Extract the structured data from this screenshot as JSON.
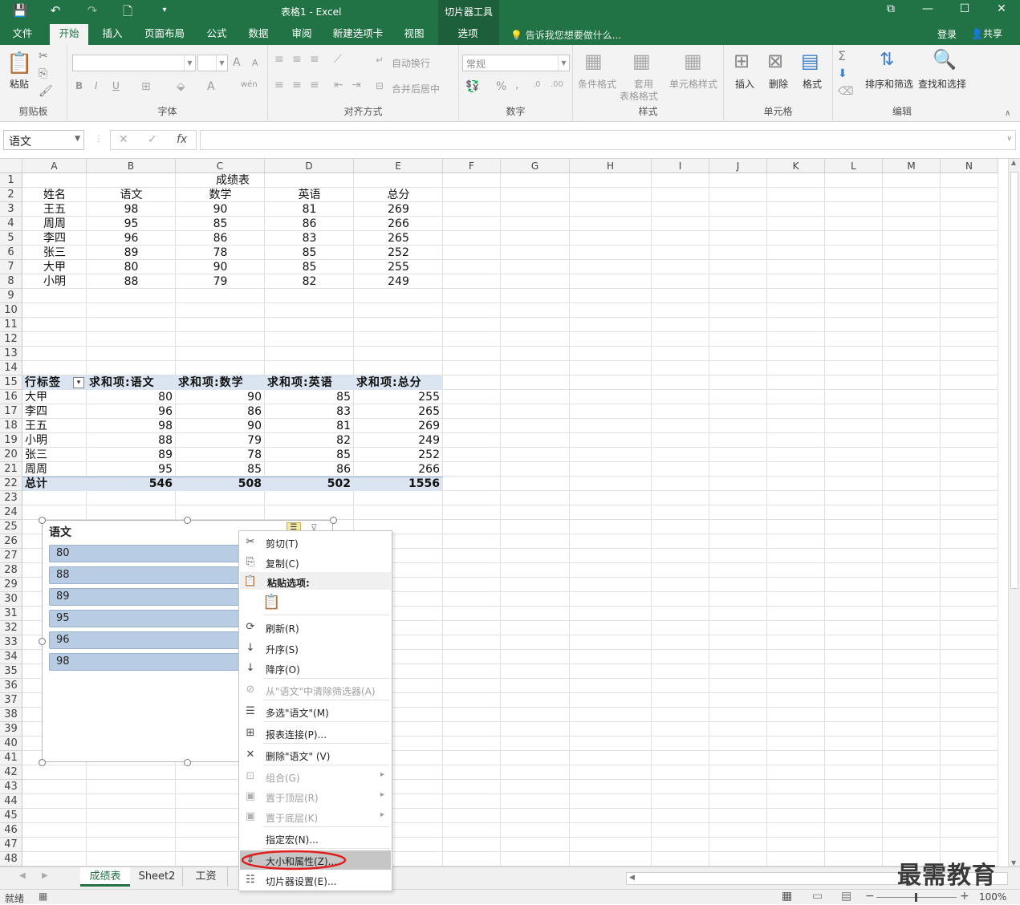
{
  "window": {
    "title": "表格1 - Excel",
    "context_tool": "切片器工具",
    "buttons": {
      "restore": "⧉",
      "minimize": "—",
      "maximize": "☐",
      "close": "✕"
    }
  },
  "qat": {
    "save_icon": "💾",
    "undo_icon": "↶",
    "redo_icon": "↷",
    "new_icon": "🗋",
    "customize_icon": "▾"
  },
  "tabs": [
    "文件",
    "开始",
    "插入",
    "页面布局",
    "公式",
    "数据",
    "审阅",
    "新建选项卡",
    "视图",
    "选项"
  ],
  "active_tab": "开始",
  "tellme": "告诉我您想要做什么...",
  "account": {
    "login": "登录",
    "share": "共享"
  },
  "ribbon": {
    "clipboard": {
      "label": "剪贴板",
      "paste": "粘贴"
    },
    "font": {
      "label": "字体",
      "bold": "B",
      "italic": "I",
      "underline": "U",
      "grow": "A",
      "shrink": "A",
      "font_color": "A",
      "phonetic": "wén"
    },
    "alignment": {
      "label": "对齐方式",
      "wrap": "自动换行",
      "merge": "合并后居中"
    },
    "number": {
      "label": "数字",
      "format": "常规",
      "percent": "%",
      "comma": ","
    },
    "styles": {
      "label": "样式",
      "conditional": "条件格式",
      "table_style_1": "套用",
      "table_style_2": "表格格式",
      "cell_style": "单元格样式"
    },
    "cells": {
      "label": "单元格",
      "insert": "插入",
      "delete": "删除",
      "format": "格式"
    },
    "editing": {
      "label": "编辑",
      "sort_filter": "排序和筛选",
      "find_select": "查找和选择"
    }
  },
  "formula_bar": {
    "name_box": "语文",
    "cancel": "✕",
    "confirm": "✓",
    "fx": "fx",
    "value": ""
  },
  "columns": [
    "A",
    "B",
    "C",
    "D",
    "E",
    "F",
    "G",
    "H",
    "I",
    "J",
    "K",
    "L",
    "M",
    "N"
  ],
  "rows": [
    "1",
    "2",
    "3",
    "4",
    "5",
    "6",
    "7",
    "8",
    "9",
    "10",
    "11",
    "12",
    "13",
    "14",
    "15",
    "16",
    "17",
    "18",
    "19",
    "20",
    "21",
    "22",
    "23",
    "24",
    "25",
    "26",
    "27",
    "28",
    "29",
    "30",
    "31",
    "32",
    "33",
    "34",
    "35",
    "36",
    "37",
    "38",
    "39",
    "40",
    "41",
    "42",
    "43",
    "44",
    "45",
    "46",
    "47",
    "48"
  ],
  "score_table": {
    "title": "成绩表",
    "headers": [
      "姓名",
      "语文",
      "数学",
      "英语",
      "总分"
    ],
    "rows": [
      [
        "王五",
        "98",
        "90",
        "81",
        "269"
      ],
      [
        "周周",
        "95",
        "85",
        "86",
        "266"
      ],
      [
        "李四",
        "96",
        "86",
        "83",
        "265"
      ],
      [
        "张三",
        "89",
        "78",
        "85",
        "252"
      ],
      [
        "大甲",
        "80",
        "90",
        "85",
        "255"
      ],
      [
        "小明",
        "88",
        "79",
        "82",
        "249"
      ]
    ]
  },
  "pivot": {
    "headers": [
      "行标签",
      "求和项:语文",
      "求和项:数学",
      "求和项:英语",
      "求和项:总分"
    ],
    "filter_icon": "▾",
    "rows": [
      [
        "大甲",
        "80",
        "90",
        "85",
        "255"
      ],
      [
        "李四",
        "96",
        "86",
        "83",
        "265"
      ],
      [
        "王五",
        "98",
        "90",
        "81",
        "269"
      ],
      [
        "小明",
        "88",
        "79",
        "82",
        "249"
      ],
      [
        "张三",
        "89",
        "78",
        "85",
        "252"
      ],
      [
        "周周",
        "95",
        "85",
        "86",
        "266"
      ]
    ],
    "total": [
      "总计",
      "546",
      "508",
      "502",
      "1556"
    ]
  },
  "slicer": {
    "title": "语文",
    "items": [
      "80",
      "88",
      "89",
      "95",
      "96",
      "98"
    ]
  },
  "context_menu": [
    {
      "label": "剪切(T)",
      "icon": "✂",
      "disabled": false
    },
    {
      "label": "复制(C)",
      "icon": "⎘",
      "disabled": false
    },
    {
      "label": "粘贴选项:",
      "icon": "📋",
      "disabled": false,
      "header": true
    },
    {
      "label": "",
      "icon": "📋",
      "disabled": false,
      "paste_option": true
    },
    {
      "label": "刷新(R)",
      "icon": "⟳",
      "disabled": false
    },
    {
      "label": "升序(S)",
      "icon": "↓",
      "disabled": false
    },
    {
      "label": "降序(O)",
      "icon": "↓",
      "disabled": false
    },
    {
      "label": "从\"语文\"中清除筛选器(A)",
      "icon": "⊘",
      "disabled": true
    },
    {
      "label": "多选\"语文\"(M)",
      "icon": "☰",
      "disabled": false
    },
    {
      "label": "报表连接(P)...",
      "icon": "⊞",
      "disabled": false
    },
    {
      "label": "删除\"语文\" (V)",
      "icon": "✕",
      "disabled": false
    },
    {
      "label": "组合(G)",
      "icon": "⊡",
      "disabled": true,
      "submenu": true
    },
    {
      "label": "置于顶层(R)",
      "icon": "▣",
      "disabled": true,
      "submenu": true
    },
    {
      "label": "置于底层(K)",
      "icon": "▣",
      "disabled": true,
      "submenu": true
    },
    {
      "label": "指定宏(N)...",
      "icon": "",
      "disabled": false
    },
    {
      "label": "大小和属性(Z)...",
      "icon": "⇕",
      "disabled": false,
      "highlighted": true
    },
    {
      "label": "切片器设置(E)...",
      "icon": "☷",
      "disabled": false
    }
  ],
  "sheets": [
    "成绩表",
    "Sheet2",
    "工资"
  ],
  "active_sheet": "成绩表",
  "status": {
    "ready": "就绪",
    "zoom": "100%"
  },
  "watermark": "最需教育",
  "colors": {
    "excel_green": "#217346",
    "pivot_blue": "#dbe5f1",
    "slicer_item": "#b8cce4",
    "highlight_ring": "#e02020"
  }
}
